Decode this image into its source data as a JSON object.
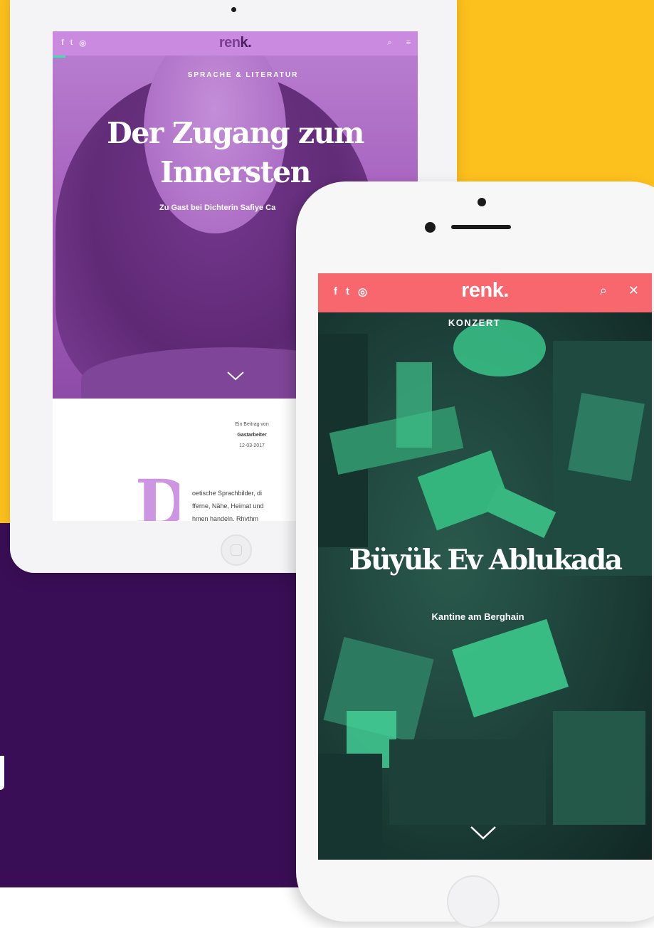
{
  "tablet": {
    "nav": {
      "social_icons": [
        "facebook-icon",
        "twitter-icon",
        "instagram-icon"
      ],
      "social_glyphs": [
        "f",
        "t",
        "◎"
      ],
      "logo_main": "ren",
      "logo_accent": "k.",
      "search_glyph": "⌕",
      "menu_glyph": "≡",
      "color": "#C98AE0"
    },
    "hero": {
      "category": "SPRACHE & LITERATUR",
      "title_line1": "Der Zugang zum",
      "title_line2": "Innersten",
      "subtitle": "Zu Gast bei Dichterin Safiye Ca"
    },
    "meta": {
      "contribution": "Ein Beitrag von",
      "author": "Gastarbeiter",
      "date": "12-03-2017"
    },
    "article": {
      "dropcap": "D",
      "lines": [
        "oetische Sprachbilder, di",
        "fferne, Nähe, Heimat und",
        "hmen handeln. Rhythm"
      ]
    }
  },
  "phone": {
    "nav": {
      "social_icons": [
        "facebook-icon",
        "twitter-icon",
        "instagram-icon"
      ],
      "social_glyphs": [
        "f",
        "t",
        "◎"
      ],
      "logo": "renk.",
      "search_glyph": "⌕",
      "close_glyph": "✕",
      "color": "#F8666E"
    },
    "hero": {
      "category": "KONZERT",
      "title": "Büyük Ev Ablukada",
      "subtitle": "Kantine am Berghain",
      "tint": "#37C98A"
    }
  },
  "colors": {
    "background_top": "#FDC11E",
    "background_bottom": "#3A0E56"
  }
}
